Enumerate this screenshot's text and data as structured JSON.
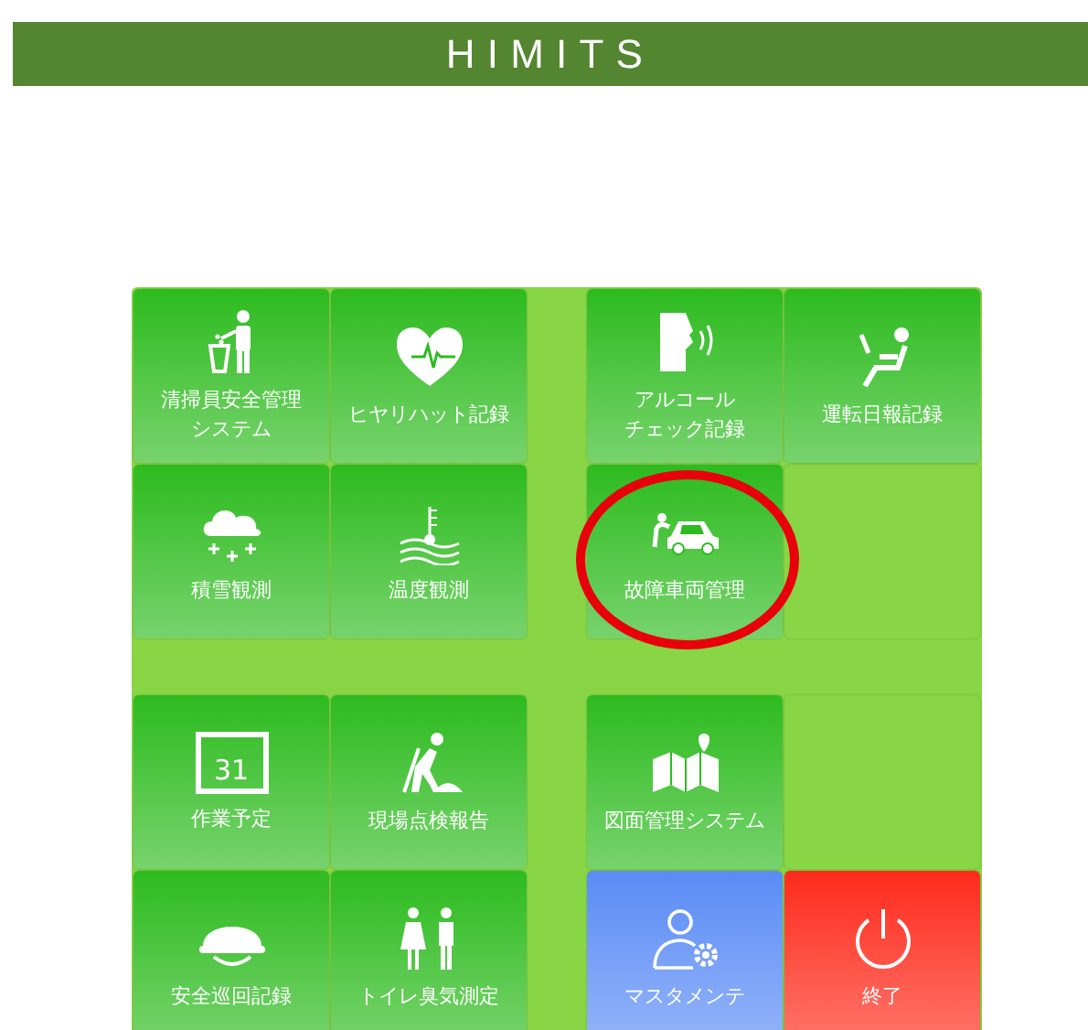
{
  "title": "HIMITS",
  "quadrants": [
    {
      "tiles": [
        {
          "kind": "app",
          "color": "#2dbb1f",
          "lines": [
            "清掃員安全管理",
            "システム"
          ],
          "highlighted": false
        },
        {
          "kind": "app",
          "color": "#2dbb1f",
          "lines": [
            "ヒヤリハット記録"
          ],
          "highlighted": false
        },
        {
          "kind": "app",
          "color": "#2dbb1f",
          "lines": [
            "積雪観測"
          ],
          "highlighted": false
        },
        {
          "kind": "app",
          "color": "#2dbb1f",
          "lines": [
            "温度観測"
          ],
          "highlighted": false
        }
      ]
    },
    {
      "tiles": [
        {
          "kind": "app",
          "color": "#2dbb1f",
          "lines": [
            "アルコール",
            "チェック記録"
          ],
          "highlighted": false
        },
        {
          "kind": "app",
          "color": "#2dbb1f",
          "lines": [
            "運転日報記録"
          ],
          "highlighted": false
        },
        {
          "kind": "app",
          "color": "#2dbb1f",
          "lines": [
            "故障車両管理"
          ],
          "highlighted": true
        },
        {
          "kind": "empty"
        }
      ]
    },
    {
      "tiles": [
        {
          "kind": "app",
          "color": "#2dbb1f",
          "icon_text": "31",
          "lines": [
            "作業予定"
          ],
          "highlighted": false
        },
        {
          "kind": "app",
          "color": "#2dbb1f",
          "lines": [
            "現場点検報告"
          ],
          "highlighted": false
        },
        {
          "kind": "app",
          "color": "#2dbb1f",
          "lines": [
            "安全巡回記録"
          ],
          "highlighted": false
        },
        {
          "kind": "app",
          "color": "#2dbb1f",
          "lines": [
            "トイレ臭気測定"
          ],
          "highlighted": false
        }
      ]
    },
    {
      "tiles": [
        {
          "kind": "app",
          "color": "#2dbb1f",
          "lines": [
            "図面管理システム"
          ],
          "highlighted": false
        },
        {
          "kind": "empty"
        },
        {
          "kind": "app",
          "color": "#5a8cf6",
          "lines": [
            "マスタメンテ"
          ],
          "highlighted": false
        },
        {
          "kind": "app",
          "color": "#ff2b1c",
          "lines": [
            "終了"
          ],
          "highlighted": false
        }
      ]
    }
  ]
}
